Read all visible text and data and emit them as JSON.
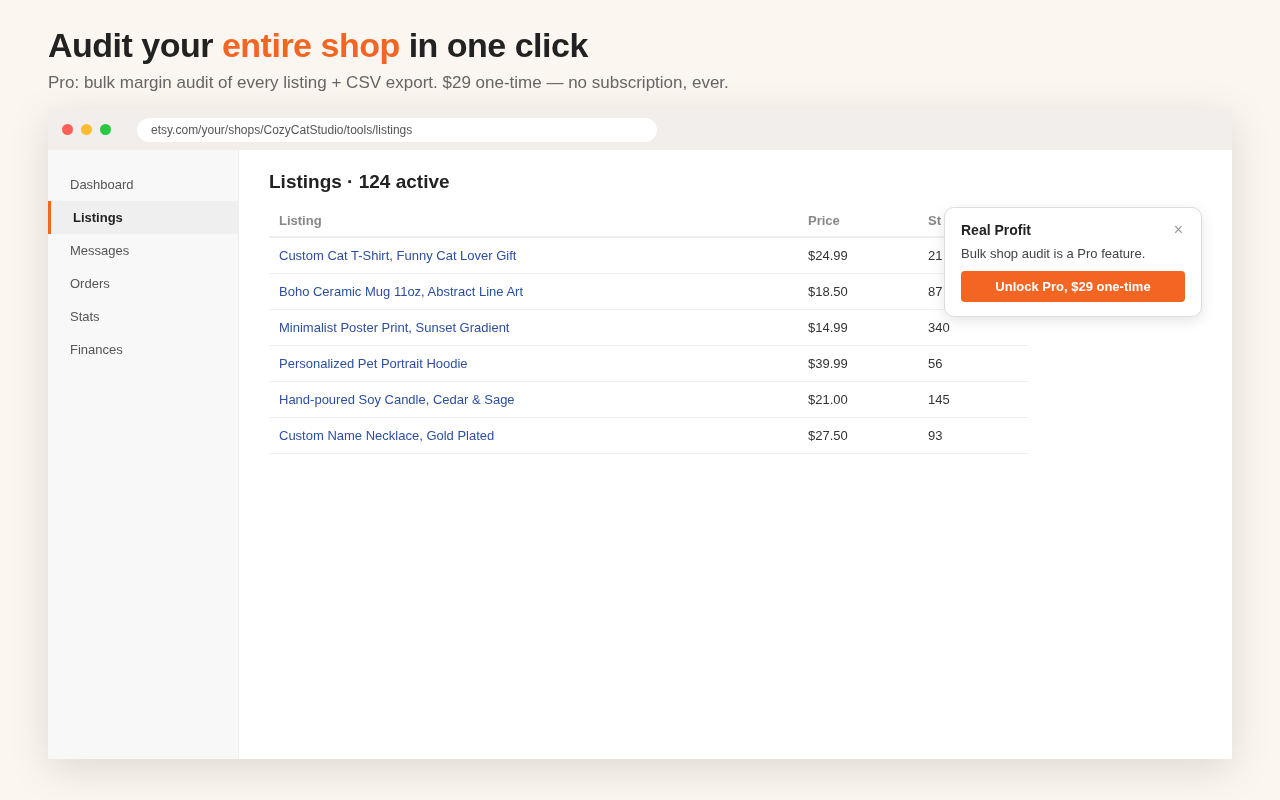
{
  "headline": "Audit your **entire shop** in one click",
  "subtitle": "Pro: bulk margin audit of every listing + CSV export. $29 one-time — no subscription, ever.",
  "browser": {
    "url": "etsy.com/your/shops/CozyCatStudio/tools/listings"
  },
  "sidebar": {
    "items": [
      {
        "label": "Dashboard",
        "selected": false
      },
      {
        "label": "Listings",
        "selected": true
      },
      {
        "label": "Messages",
        "selected": false
      },
      {
        "label": "Orders",
        "selected": false
      },
      {
        "label": "Stats",
        "selected": false
      },
      {
        "label": "Finances",
        "selected": false
      }
    ]
  },
  "page_title": "Listings · 124 active",
  "table": {
    "columns": [
      "Listing",
      "Price",
      "St"
    ],
    "rows": [
      [
        "Custom Cat T-Shirt, Funny Cat Lover Gift",
        "$24.99",
        "21"
      ],
      [
        "Boho Ceramic Mug 11oz, Abstract Line Art",
        "$18.50",
        "87"
      ],
      [
        "Minimalist Poster Print, Sunset Gradient",
        "$14.99",
        "340"
      ],
      [
        "Personalized Pet Portrait Hoodie",
        "$39.99",
        "56"
      ],
      [
        "Hand-poured Soy Candle, Cedar & Sage",
        "$21.00",
        "145"
      ],
      [
        "Custom Name Necklace, Gold Plated",
        "$27.50",
        "93"
      ]
    ]
  },
  "popup": {
    "title": "Real Profit",
    "close": "×",
    "message": "Bulk shop audit is a Pro feature.",
    "button": "Unlock Pro, $29 one-time"
  }
}
